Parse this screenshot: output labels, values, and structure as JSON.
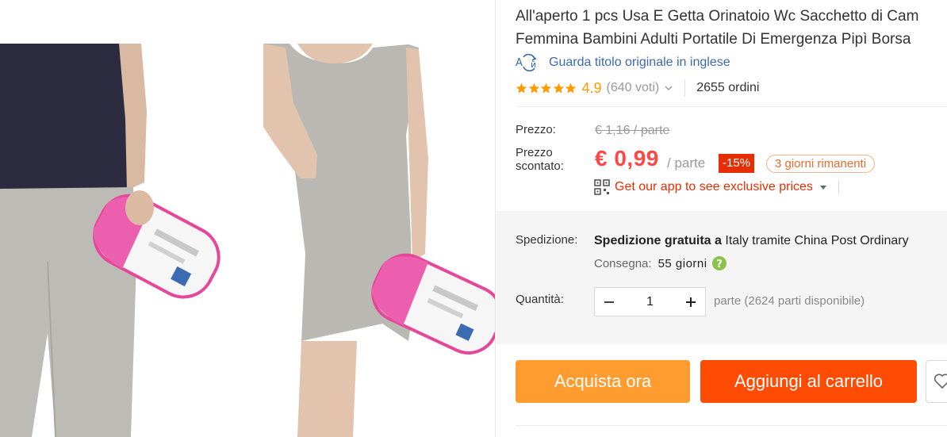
{
  "product": {
    "title_line1": "All'aperto 1 pcs Usa E Getta Orinatoio Wc Sacchetto di Cam",
    "title_line2": "Femmina Bambini Adulti Portatile Di Emergenza Pipì Borsa",
    "translate_link": "Guarda titolo originale in inglese",
    "rating": "4.9",
    "votes": "(640 voti)",
    "orders": "2655 ordini",
    "stars": 5
  },
  "pricing": {
    "price_label": "Prezzo:",
    "original_price": "€ 1,16 / parte",
    "discount_label_line1": "Prezzo",
    "discount_label_line2": "scontato:",
    "discount_price": "€ 0,99",
    "per_unit": "/ parte",
    "discount_pct": "-15%",
    "days_left": "3 giorni rimanenti",
    "app_promo": "Get our app to see exclusive prices"
  },
  "shipping": {
    "label": "Spedizione:",
    "free_text": "Spedizione gratuita a",
    "destination": "Italy tramite China Post Ordinary",
    "delivery_label": "Consegna:",
    "delivery_days": "55 giorni"
  },
  "quantity": {
    "label": "Quantità:",
    "value": "1",
    "available": "parte (2624 parti disponibile)"
  },
  "actions": {
    "buy_now": "Acquista ora",
    "add_to_cart": "Aggiungi al carrello"
  },
  "colors": {
    "price_red": "#ff4747",
    "rating_orange": "#ff9a00",
    "buy_button": "#ff9c30",
    "cart_button": "#ff4c04",
    "link_blue": "#3a6ab2",
    "badge_red": "#e62e04"
  }
}
